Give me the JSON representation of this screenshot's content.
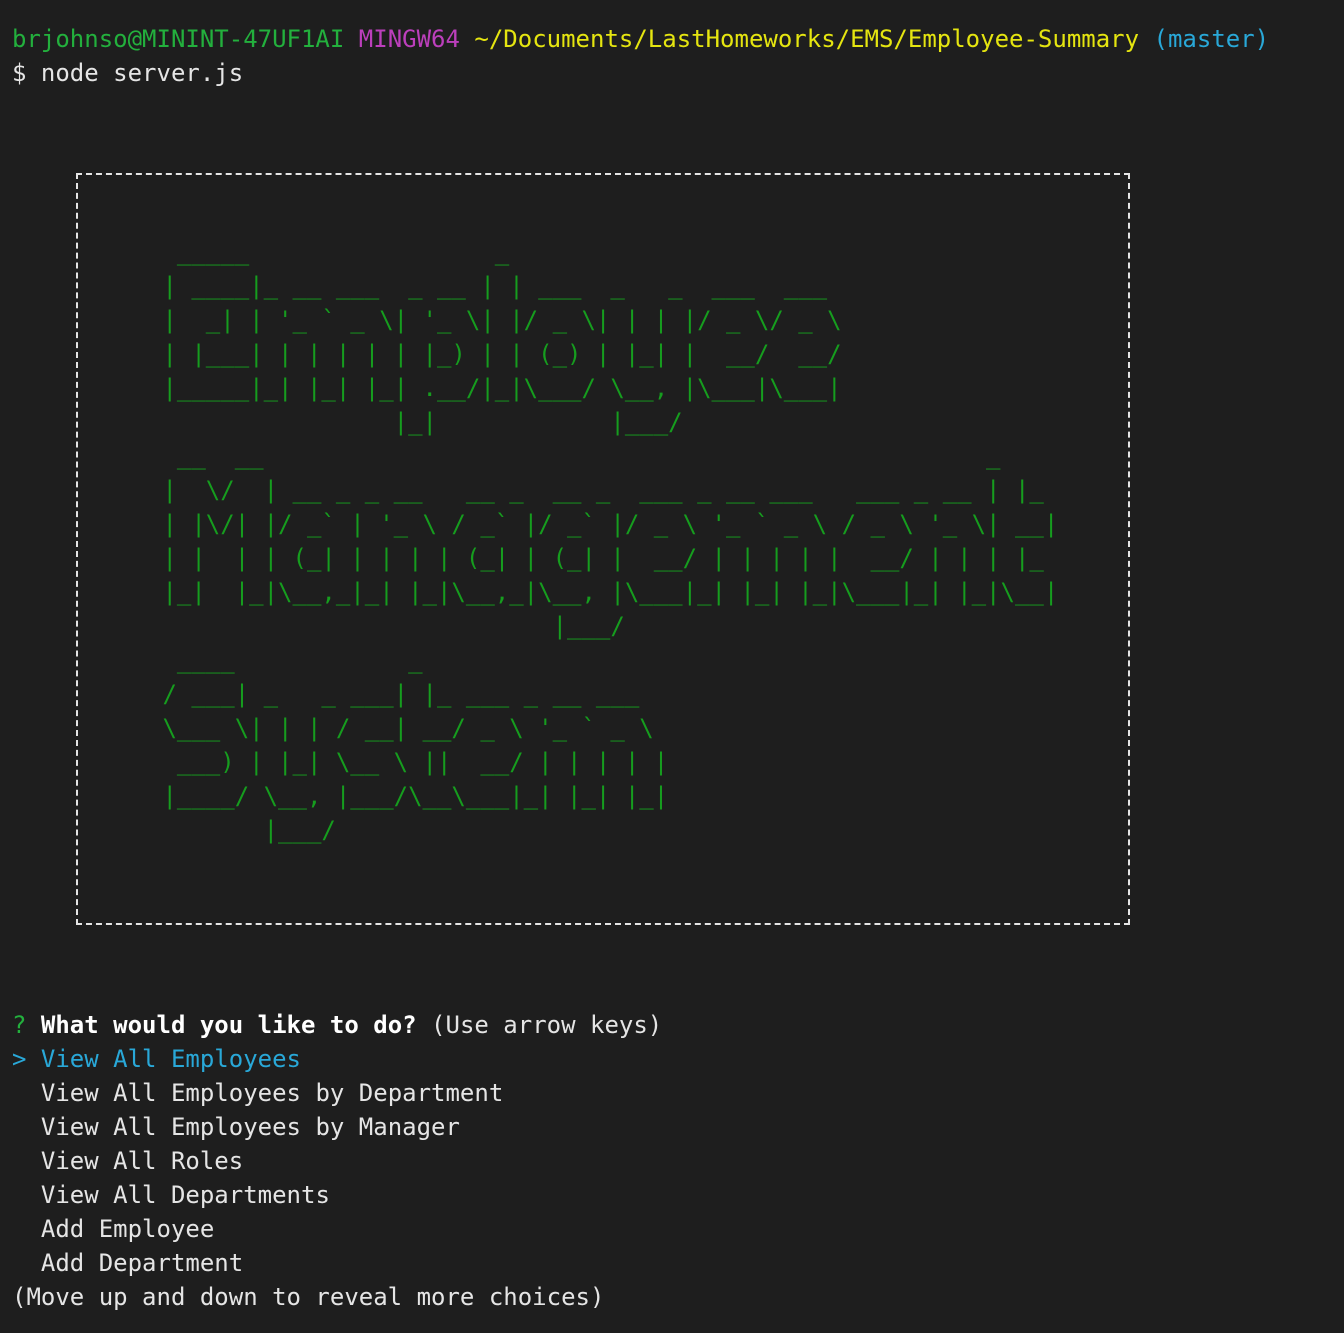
{
  "terminal": {
    "user_host": "brjohnso@MININT-47UF1AI",
    "env": "MINGW64",
    "cwd": "~/Documents/LastHomeworks/EMS/Employee-Summary",
    "branch": "(master)",
    "prompt_symbol": "$",
    "command": "node server.js"
  },
  "banner": {
    "ascii_art": "  _____                 _\n | ____|_ __ ___  _ __ | | ___  _   _  ___  ___\n |  _| | '_ ` _ \\| '_ \\| |/ _ \\| | | |/ _ \\/ _ \\\n | |___| | | | | | |_) | | (_) | |_| |  __/  __/\n |_____|_| |_| |_| .__/|_|\\___/ \\__, |\\___|\\___|\n                 |_|            |___/\n  __  __                                                  _\n |  \\/  | __ _ _ __   __ _  __ _  ___ _ __ ___   ___ _ __ | |_\n | |\\/| |/ _` | '_ \\ / _` |/ _` |/ _ \\ '_ ` _ \\ / _ \\ '_ \\| __|\n | |  | | (_| | | | | (_| | (_| |  __/ | | | | |  __/ | | | |_\n |_|  |_|\\__,_|_| |_|\\__,_|\\__, |\\___|_| |_| |_|\\___|_| |_|\\__|\n                            |___/\n  ____            _\n / ___| _   _ ___| |_ ___ _ __ ___\n \\___ \\| | | / __| __/ _ \\ '_ ` _ \\\n  ___) | |_| \\__ \\ ||  __/ | | | | |\n |____/ \\__, |___/\\__\\___|_| |_| |_|\n        |___/"
  },
  "inquirer": {
    "prompt_mark": "?",
    "question": "What would you like to do?",
    "hint": "(Use arrow keys)",
    "pointer": ">",
    "choices": [
      "View All Employees",
      "View All Employees by Department",
      "View All Employees by Manager",
      "View All Roles",
      "View All Departments",
      "Add Employee",
      "Add Department"
    ],
    "selected_index": 0,
    "footer": "(Move up and down to reveal more choices)"
  },
  "colors": {
    "background": "#1e1e1e",
    "user": "#23b03d",
    "env": "#bc3fbc",
    "path": "#e5e510",
    "branch": "#29a8d8",
    "ascii_green": "#169d1e",
    "selected": "#29a8d8"
  }
}
